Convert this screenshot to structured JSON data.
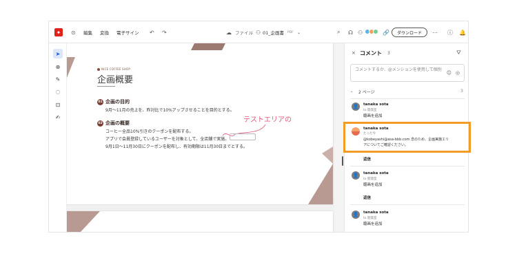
{
  "toolbar": {
    "menu_edit": "編集",
    "menu_convert": "変換",
    "menu_sign": "電子サイン",
    "file_label": "ファイル",
    "file_name": "01_企画書",
    "file_type": "PDF",
    "download_label": "ダウンロード"
  },
  "document": {
    "brand": "NICE COFFEE SHOP",
    "title": "企画概要",
    "section1": {
      "num": "01",
      "heading": "企画の目的",
      "lines": [
        "9月〜11月の売上を、昨対比で10%アップさせることを目的とする。"
      ]
    },
    "section2": {
      "num": "02",
      "heading": "企画の概要",
      "lines": [
        "コーヒー全品10%引きのクーポンを配布する。",
        "アプリで会員登録しているユーザーを対象として、全店舗で実施。",
        "9月1日〜11月30日にクーポンを配布し、有効期限は11月30日までとする。"
      ]
    },
    "annotation": "テストエリアの"
  },
  "panel": {
    "title": "コメント",
    "count": "3",
    "input_placeholder": "コメントするか、@メンションを使用して個別",
    "page_section": "2 ページ",
    "page_count": "3",
    "comments": [
      {
        "author": "tanaka sota",
        "sub": "to 開発室",
        "text": "聴画を追加"
      },
      {
        "author": "tanaka sota",
        "sub": "たった今",
        "text1": "@kobeyashi@asa-bbb.com 念のため、企画実施エリ",
        "text2": "アについてご確認ください。",
        "reply": "返信"
      },
      {
        "author": "tanaka sota",
        "sub": "to 開発室",
        "text": "聴画を追加",
        "reply": "返信"
      },
      {
        "author": "tanaka sota",
        "sub": "to 開発室",
        "text": "聴画を追加"
      }
    ]
  },
  "colors": {
    "accent": "#e0221b",
    "highlight": "#f29b26",
    "annotation": "#e4567a",
    "section": "#7a3e32"
  },
  "icons": [
    "acrobat-logo-icon",
    "history-icon",
    "undo-icon",
    "redo-icon",
    "cloud-icon",
    "people-icon",
    "search-icon",
    "headset-icon",
    "link-icon",
    "more-icon",
    "help-icon",
    "bell-icon",
    "cursor-icon",
    "comment-tool-icon",
    "pen-icon",
    "lasso-icon",
    "text-select-icon",
    "sign-icon",
    "filter-icon",
    "close-icon",
    "emoji-icon",
    "mention-icon"
  ]
}
